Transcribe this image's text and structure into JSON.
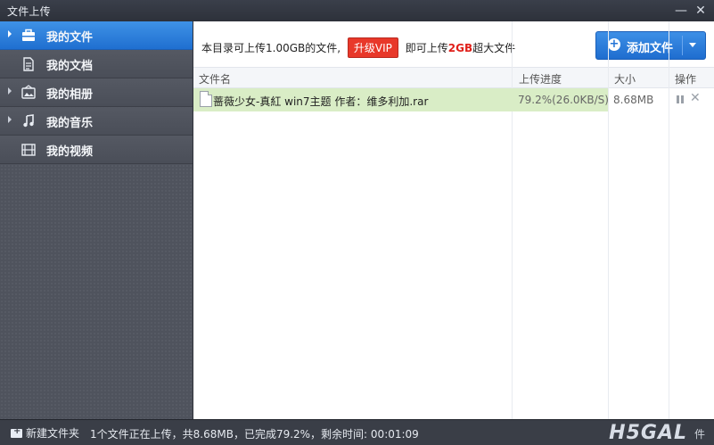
{
  "window": {
    "title": "文件上传",
    "minimize": "—",
    "close": "✕"
  },
  "sidebar": {
    "items": [
      {
        "label": "我的文件",
        "icon": "briefcase-icon",
        "active": true,
        "expandable": true
      },
      {
        "label": "我的文档",
        "icon": "document-icon",
        "active": false,
        "expandable": false
      },
      {
        "label": "我的相册",
        "icon": "photo-album-icon",
        "active": false,
        "expandable": true
      },
      {
        "label": "我的音乐",
        "icon": "music-note-icon",
        "active": false,
        "expandable": true
      },
      {
        "label": "我的视频",
        "icon": "film-icon",
        "active": false,
        "expandable": false
      }
    ]
  },
  "notice": {
    "before": "本目录可上传1.00GB的文件,",
    "vip_button": "升级VIP",
    "middle": "即可上传",
    "highlight": "2GB",
    "after": "超大文件"
  },
  "add_button": {
    "label": "添加文件"
  },
  "table": {
    "columns": {
      "name": "文件名",
      "progress": "上传进度",
      "size": "大小",
      "actions": "操作"
    },
    "rows": [
      {
        "file_name": "蔷薇少女-真紅 win7主题 作者：维多利加.rar",
        "progress_text": "79.2%(26.0KB/S)",
        "progress_fraction": 0.792,
        "size": "8.68MB"
      }
    ]
  },
  "status": {
    "new_folder": "新建文件夹",
    "text": "1个文件正在上传，共8.68MB，已完成79.2%，剩余时间: 00:01:09",
    "watermark": "H5GAL",
    "watermark_tail": "件"
  },
  "colors": {
    "accent": "#2474d6",
    "progress": "#d9edc6",
    "vip": "#e8382a"
  }
}
